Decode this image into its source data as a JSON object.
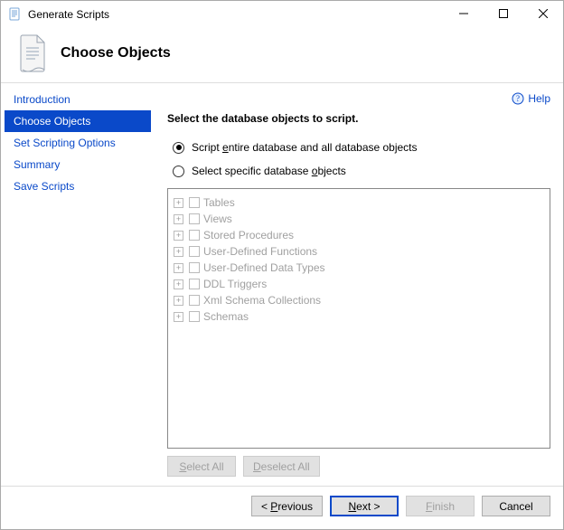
{
  "window": {
    "title": "Generate Scripts"
  },
  "header": {
    "title": "Choose Objects"
  },
  "help": {
    "label": "Help"
  },
  "nav": {
    "items": [
      {
        "label": "Introduction",
        "selected": false
      },
      {
        "label": "Choose Objects",
        "selected": true
      },
      {
        "label": "Set Scripting Options",
        "selected": false
      },
      {
        "label": "Summary",
        "selected": false
      },
      {
        "label": "Save Scripts",
        "selected": false
      }
    ]
  },
  "panel": {
    "heading": "Select the database objects to script.",
    "radios": {
      "entire": {
        "pre": "Script ",
        "hot": "e",
        "post": "ntire database and all database objects",
        "checked": true
      },
      "specific": {
        "pre": "Select specific database ",
        "hot": "o",
        "post": "bjects",
        "checked": false
      }
    },
    "tree": [
      {
        "label": "Tables"
      },
      {
        "label": "Views"
      },
      {
        "label": "Stored Procedures"
      },
      {
        "label": "User-Defined Functions"
      },
      {
        "label": "User-Defined Data Types"
      },
      {
        "label": "DDL Triggers"
      },
      {
        "label": "Xml Schema Collections"
      },
      {
        "label": "Schemas"
      }
    ],
    "tree_actions": {
      "select_all": {
        "pre": "",
        "hot": "S",
        "post": "elect All"
      },
      "deselect_all": {
        "pre": "",
        "hot": "D",
        "post": "eselect All"
      }
    }
  },
  "footer": {
    "previous": {
      "pre": "< ",
      "hot": "P",
      "post": "revious"
    },
    "next": {
      "pre": "",
      "hot": "N",
      "post": "ext >"
    },
    "finish": {
      "pre": "",
      "hot": "F",
      "post": "inish"
    },
    "cancel": {
      "label": "Cancel"
    }
  }
}
